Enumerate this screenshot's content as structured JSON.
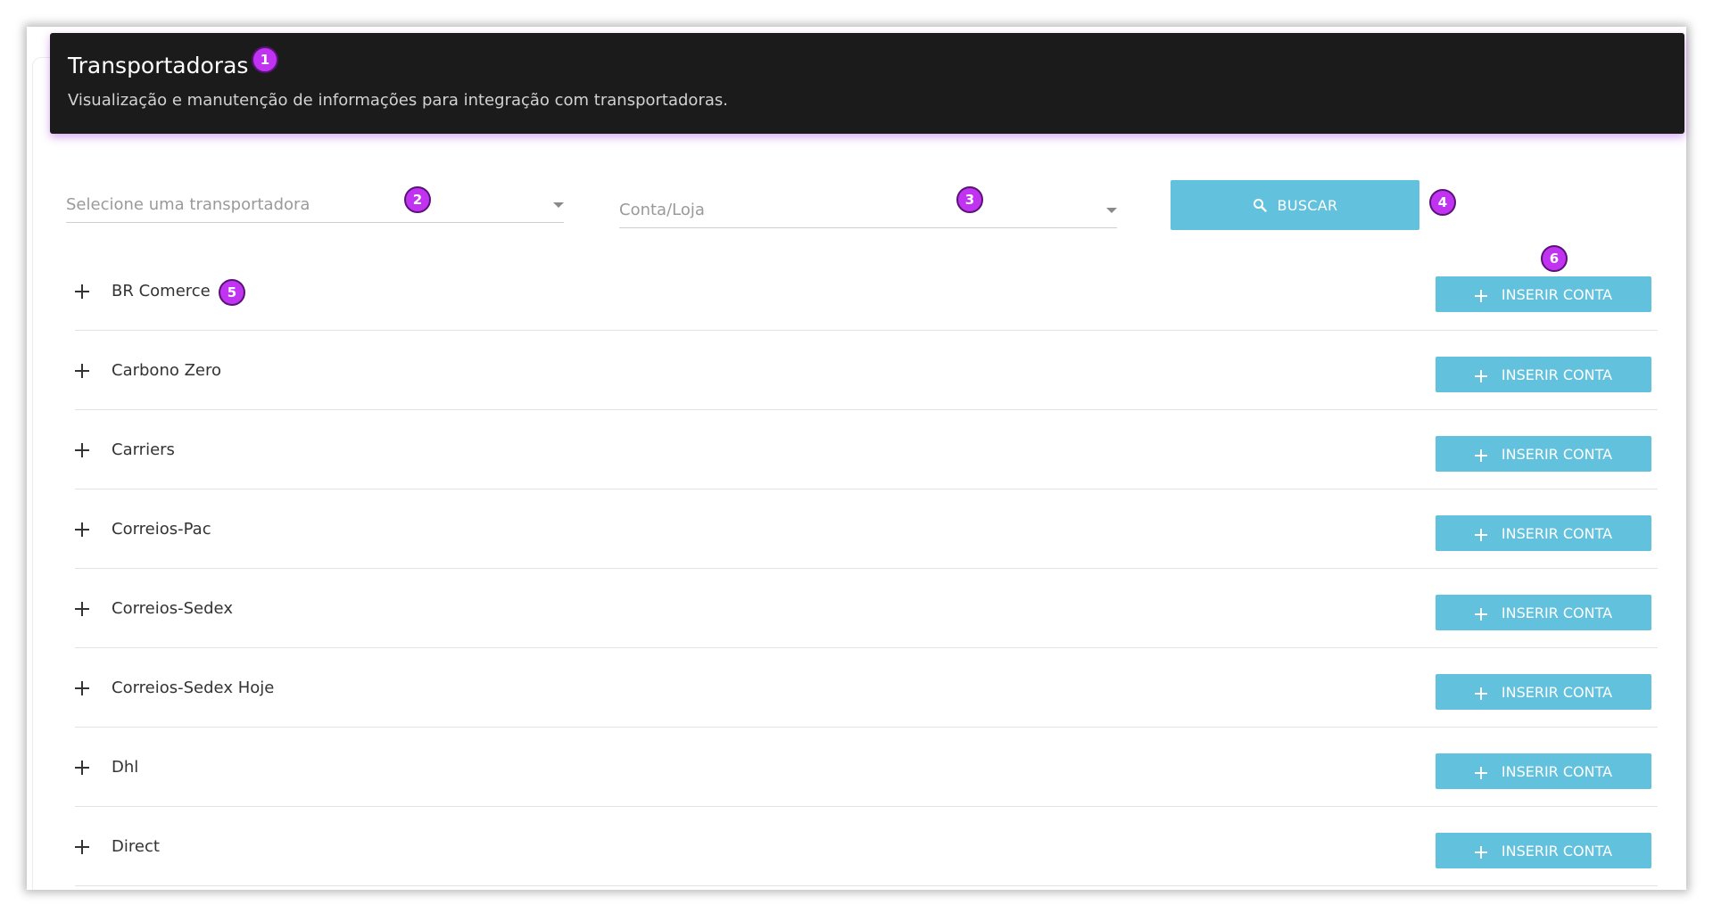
{
  "header": {
    "title": "Transportadoras",
    "subtitle": "Visualização e manutenção de informações para integração com transportadoras."
  },
  "filters": {
    "carrier_placeholder": "Selecione uma transportadora",
    "account_placeholder": "Conta/Loja",
    "search_label": "BUSCAR"
  },
  "badges": [
    "1",
    "2",
    "3",
    "4",
    "5",
    "6"
  ],
  "carriers": [
    {
      "name": "BR Comerce",
      "button": "INSERIR CONTA"
    },
    {
      "name": "Carbono Zero",
      "button": "INSERIR CONTA"
    },
    {
      "name": "Carriers",
      "button": "INSERIR CONTA"
    },
    {
      "name": "Correios-Pac",
      "button": "INSERIR CONTA"
    },
    {
      "name": "Correios-Sedex",
      "button": "INSERIR CONTA"
    },
    {
      "name": "Correios-Sedex Hoje",
      "button": "INSERIR CONTA"
    },
    {
      "name": "Dhl",
      "button": "INSERIR CONTA"
    },
    {
      "name": "Direct",
      "button": "INSERIR CONTA"
    }
  ],
  "colors": {
    "header_bg": "#1b1b1b",
    "accent_button": "#62c1dd",
    "badge": "#c033f0"
  }
}
